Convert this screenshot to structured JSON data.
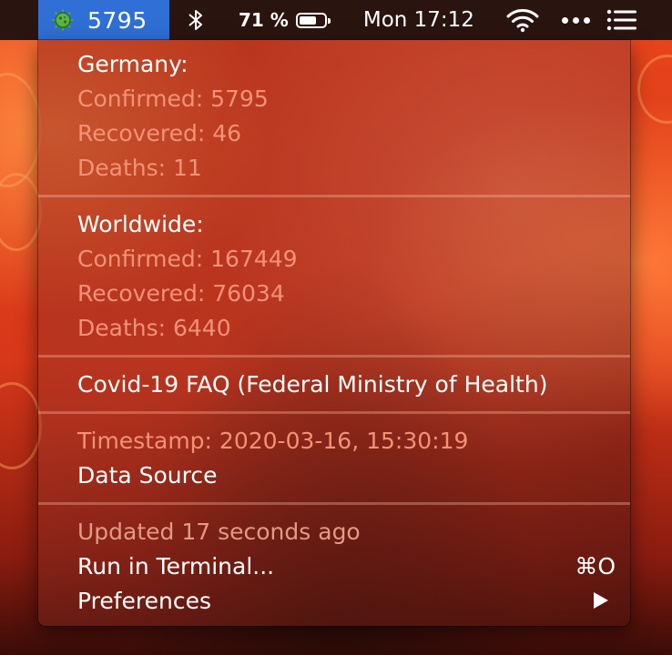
{
  "menubar": {
    "status_count": "5795",
    "battery_percent": "71 %",
    "battery_level": 0.71,
    "clock": "Mon 17:12",
    "icons": [
      "virus-icon",
      "bluetooth-icon",
      "battery-icon",
      "wifi-icon",
      "more-icon",
      "list-icon"
    ]
  },
  "menu": {
    "germany": {
      "heading": "Germany:",
      "confirmed": "Confirmed: 5795",
      "recovered": "Recovered: 46",
      "deaths": "Deaths: 11"
    },
    "worldwide": {
      "heading": "Worldwide:",
      "confirmed": "Confirmed: 167449",
      "recovered": "Recovered: 76034",
      "deaths": "Deaths: 6440"
    },
    "faq_link": "Covid-19 FAQ (Federal Ministry of Health)",
    "timestamp": "Timestamp: 2020-03-16, 15:30:19",
    "data_source": "Data Source",
    "updated": "Updated 17 seconds ago",
    "run_in_terminal": "Run in Terminal...",
    "run_shortcut": "⌘O",
    "preferences": "Preferences"
  },
  "colors": {
    "status_highlight": "#2f6fd6",
    "menubar_bg": "#2a1410",
    "dim_text": "#f39276"
  }
}
